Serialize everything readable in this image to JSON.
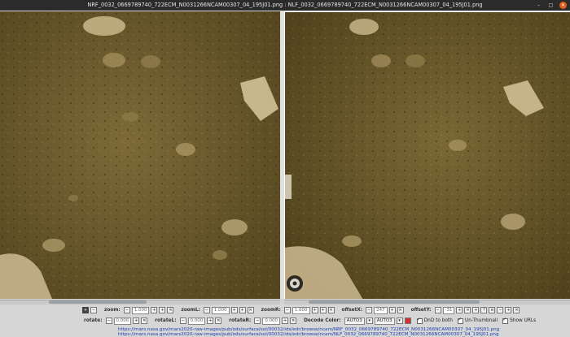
{
  "window": {
    "title": "NRF_0032_0669789740_722ECM_N0031266NCAM00307_04_195J01.png : NLF_0032_0669789740_722ECM_N0031266NCAM00307_04_195J01.png",
    "min_glyph": "–",
    "max_glyph": "□",
    "close_glyph": "✕"
  },
  "controls": {
    "row1": {
      "zoom_label": "zoom:",
      "zoom_value": "1.000",
      "zoomL_label": "zoomL:",
      "zoomL_value": "1.000",
      "zoomR_label": "zoomR:",
      "zoomR_value": "1.000",
      "offsetX_label": "offsetX:",
      "offsetX_value": "247",
      "offsetY_label": "offsetY:",
      "offsetY_value": "-31"
    },
    "row2": {
      "rotate_label": "rotate:",
      "rotate_value": "0.000",
      "rotateL_label": "rotateL:",
      "rotateL_value": "0.000",
      "rotateR_label": "rotateR:",
      "rotateR_value": "0.000",
      "decode_label": "Decode Color:",
      "decode_left": "AUTO3",
      "decode_right": "AUTO3",
      "dnd_label": "DnD to both",
      "unthumb_label": "Un-Thumbnail",
      "urls_label": "Show URLs"
    },
    "glyphs": {
      "minus": "−",
      "plus": "+",
      "close": "✕",
      "dropdown": "▾",
      "help": "?",
      "menu": "≡"
    }
  },
  "urls": [
    "https://mars.nasa.gov/mars2020-raw-images/pub/ods/surface/sol/00032/ids/edr/browse/ncam/NRF_0032_0669789740_722ECM_N0031266NCAM00307_04_195J01.png",
    "https://mars.nasa.gov/mars2020-raw-images/pub/ods/surface/sol/00032/ids/edr/browse/ncam/NLF_0032_0669789740_722ECM_N0031266NCAM00307_04_195J01.png"
  ],
  "colors": {
    "terrain": "#6b5a2e",
    "link": "#1a3fb0"
  }
}
